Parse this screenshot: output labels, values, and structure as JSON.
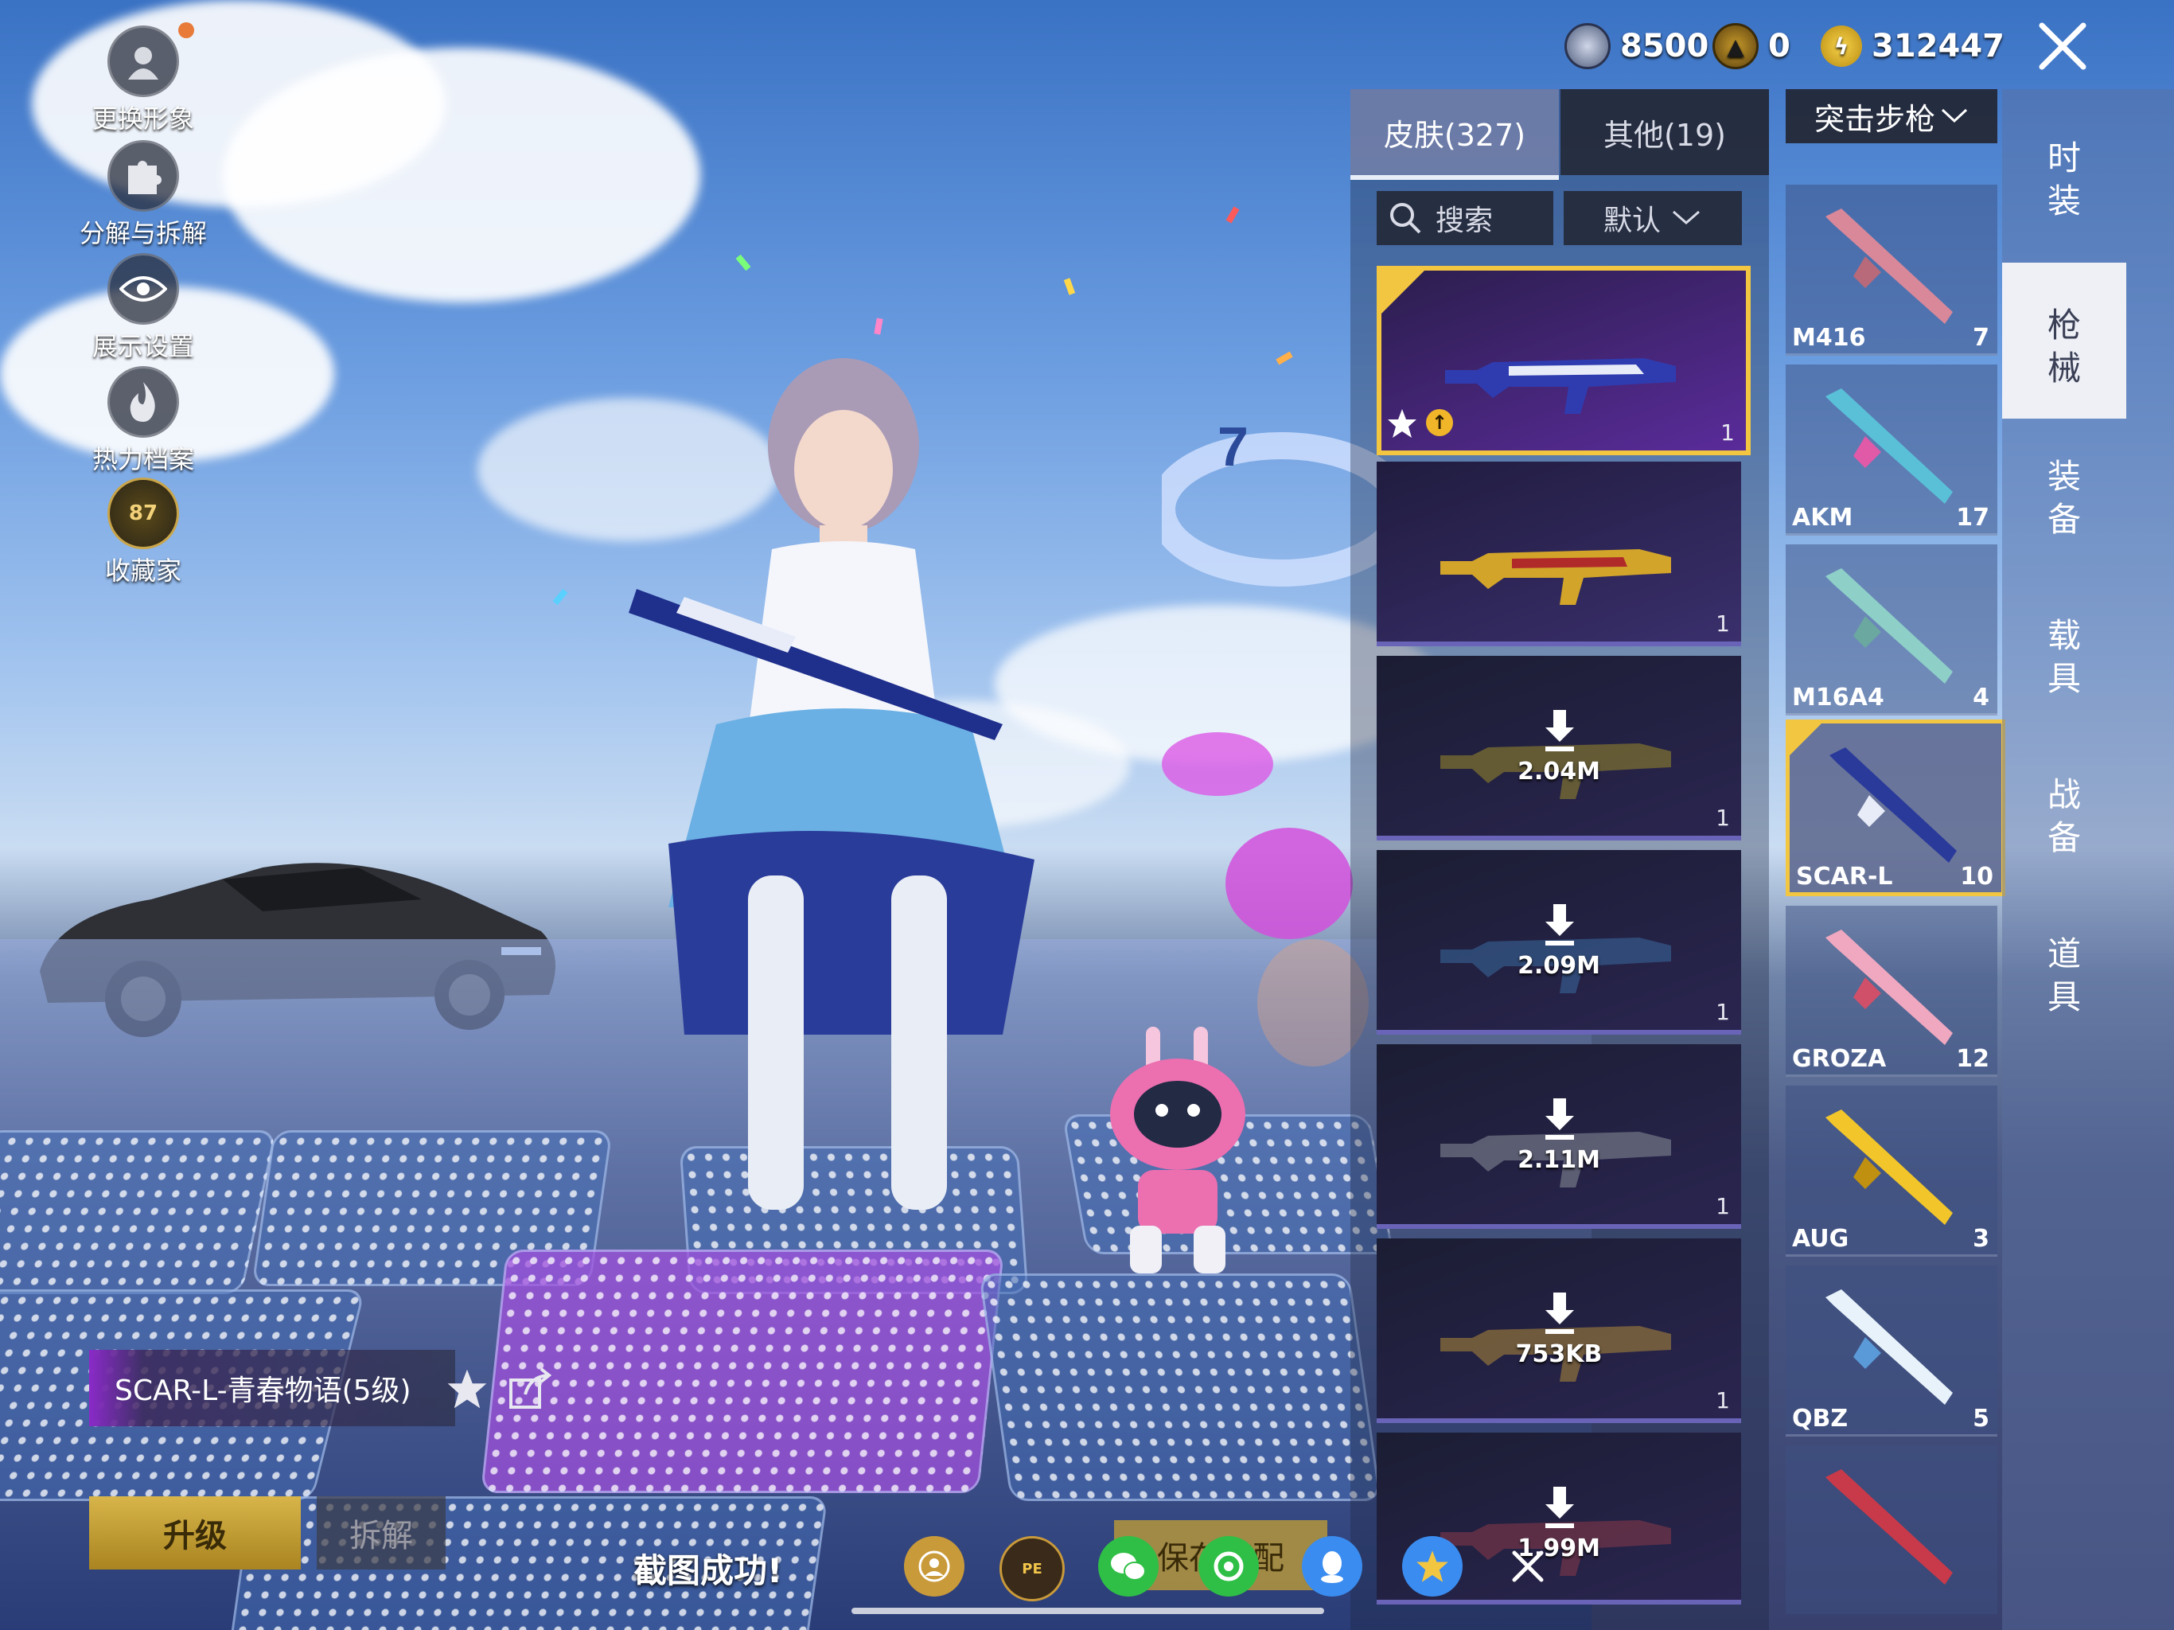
{
  "left_menu": [
    {
      "label": "更换形象",
      "icon": "avatar-icon"
    },
    {
      "label": "分解与拆解",
      "icon": "puzzle-icon"
    },
    {
      "label": "展示设置",
      "icon": "eye-icon"
    },
    {
      "label": "热力档案",
      "icon": "flame-icon"
    },
    {
      "label": "收藏家",
      "icon": "collector-badge-icon",
      "badge": "87"
    }
  ],
  "currency": [
    {
      "value": "8500",
      "icon": "silver-coin-icon"
    },
    {
      "value": "0",
      "icon": "gold-token-icon"
    },
    {
      "value": "312447",
      "icon": "lightning-coin-icon"
    }
  ],
  "tabs": [
    {
      "label": "皮肤(327)",
      "active": true
    },
    {
      "label": "其他(19)",
      "active": false
    }
  ],
  "search": {
    "placeholder": "搜索"
  },
  "sort": {
    "label": "默认"
  },
  "category_dropdown": {
    "label": "突击步枪"
  },
  "skins": [
    {
      "qty": "1",
      "size": "",
      "selected": true
    },
    {
      "qty": "1",
      "size": "",
      "selected": false
    },
    {
      "qty": "1",
      "size": "2.04M",
      "selected": false
    },
    {
      "qty": "1",
      "size": "2.09M",
      "selected": false
    },
    {
      "qty": "1",
      "size": "2.11M",
      "selected": false
    },
    {
      "qty": "1",
      "size": "753KB",
      "selected": false
    },
    {
      "qty": "",
      "size": "1.99M",
      "selected": false
    }
  ],
  "gun_categories": [
    {
      "name": "M416",
      "count": "7"
    },
    {
      "name": "AKM",
      "count": "17"
    },
    {
      "name": "M16A4",
      "count": "4"
    },
    {
      "name": "SCAR-L",
      "count": "10",
      "selected": true
    },
    {
      "name": "GROZA",
      "count": "12"
    },
    {
      "name": "AUG",
      "count": "3"
    },
    {
      "name": "QBZ",
      "count": "5"
    },
    {
      "name": "",
      "count": ""
    }
  ],
  "right_tabs": [
    {
      "label": "时装",
      "active": false
    },
    {
      "label": "枪械",
      "active": true
    },
    {
      "label": "装备",
      "active": false
    },
    {
      "label": "载具",
      "active": false
    },
    {
      "label": "战备",
      "active": false
    },
    {
      "label": "道具",
      "active": false
    }
  ],
  "weapon_info": {
    "name": "SCAR-L-青春物语(5级)"
  },
  "buttons": {
    "upgrade": "升级",
    "dismantle": "拆解",
    "save": "保存搭配"
  },
  "screenshot_toast": "截图成功!",
  "share_icons": [
    "profile-share-icon",
    "game-logo-icon",
    "wechat-icon",
    "moments-icon",
    "qq-icon",
    "qzone-icon",
    "close-icon"
  ],
  "colors": {
    "accent_gold": "#f3c642",
    "selected_purple": "#5a2b9a"
  }
}
